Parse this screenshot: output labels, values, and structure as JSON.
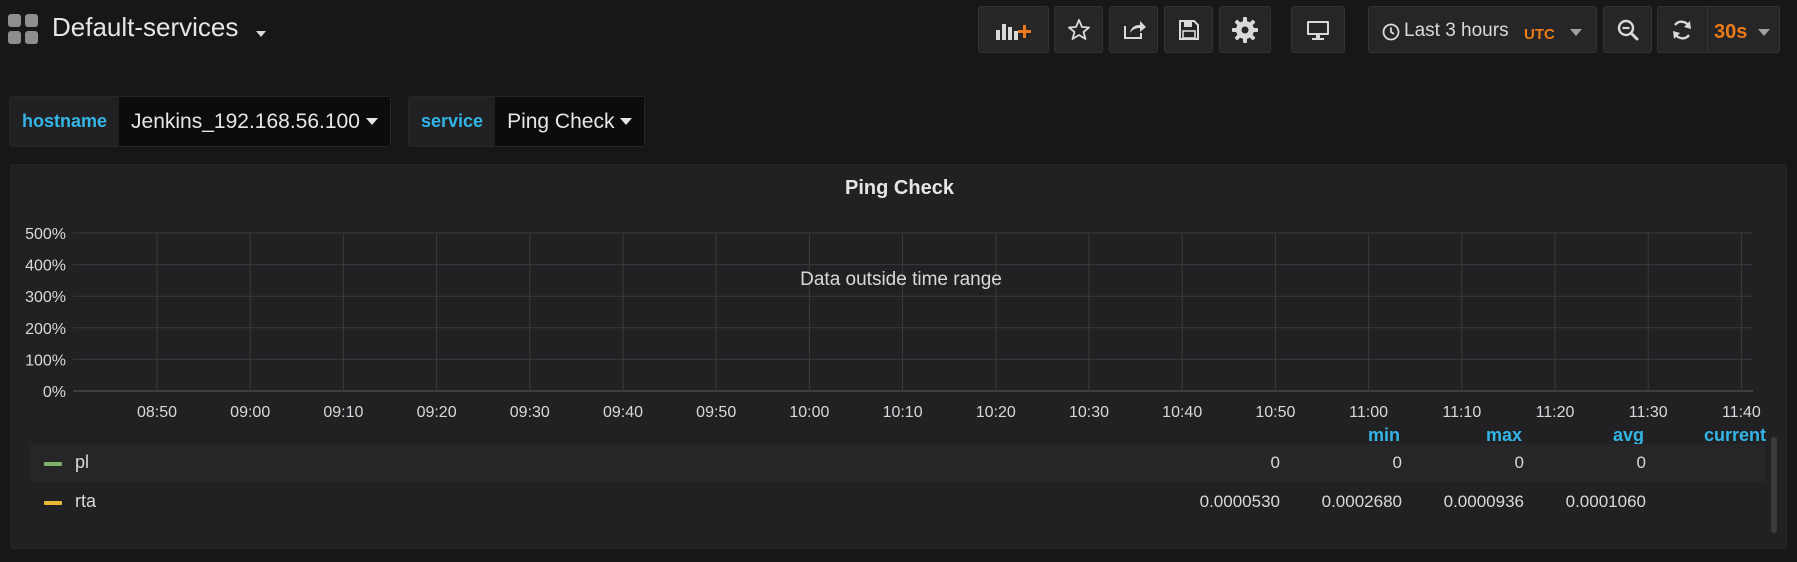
{
  "dashboard": {
    "title": "Default-services"
  },
  "toolbar": {
    "buttons": [
      {
        "name": "add-panel",
        "icon": "bar-chart-plus-icon"
      },
      {
        "name": "star",
        "icon": "star-icon"
      },
      {
        "name": "share",
        "icon": "share-icon"
      },
      {
        "name": "save",
        "icon": "floppy-disk-icon"
      },
      {
        "name": "settings",
        "icon": "gear-icon"
      },
      {
        "name": "view-mode",
        "icon": "monitor-icon"
      }
    ],
    "time_range": "Last 3 hours",
    "timezone": "UTC",
    "zoom_icon": "zoom-out-icon",
    "refresh_icon": "refresh-icon",
    "refresh_interval": "30s"
  },
  "variables": [
    {
      "label": "hostname",
      "value": "Jenkins_192.168.56.100"
    },
    {
      "label": "service",
      "value": "Ping Check"
    }
  ],
  "panel": {
    "title": "Ping Check",
    "message": "Data outside time range"
  },
  "chart_data": {
    "type": "line",
    "title": "Ping Check",
    "ylim": [
      0,
      500
    ],
    "yticks": [
      "0%",
      "100%",
      "200%",
      "300%",
      "400%",
      "500%"
    ],
    "xticks": [
      "08:50",
      "09:00",
      "09:10",
      "09:20",
      "09:30",
      "09:40",
      "09:50",
      "10:00",
      "10:10",
      "10:20",
      "10:30",
      "10:40",
      "10:50",
      "11:00",
      "11:10",
      "11:20",
      "11:30",
      "11:40"
    ],
    "grid": true,
    "series": [
      {
        "name": "pl",
        "values": []
      },
      {
        "name": "rta",
        "values": []
      }
    ]
  },
  "legend": {
    "columns": [
      "min",
      "max",
      "avg",
      "current"
    ],
    "rows": [
      {
        "name": "pl",
        "color": "#7eb26d",
        "min": "0",
        "max": "0",
        "avg": "0",
        "current": "0"
      },
      {
        "name": "rta",
        "color": "#eab839",
        "min": "0.0000530",
        "max": "0.0002680",
        "avg": "0.0000936",
        "current": "0.0001060"
      }
    ]
  },
  "colors": {
    "background": "#161719",
    "panel": "#212124",
    "accent_blue": "#33b5e5",
    "accent_orange": "#eb7b18"
  }
}
